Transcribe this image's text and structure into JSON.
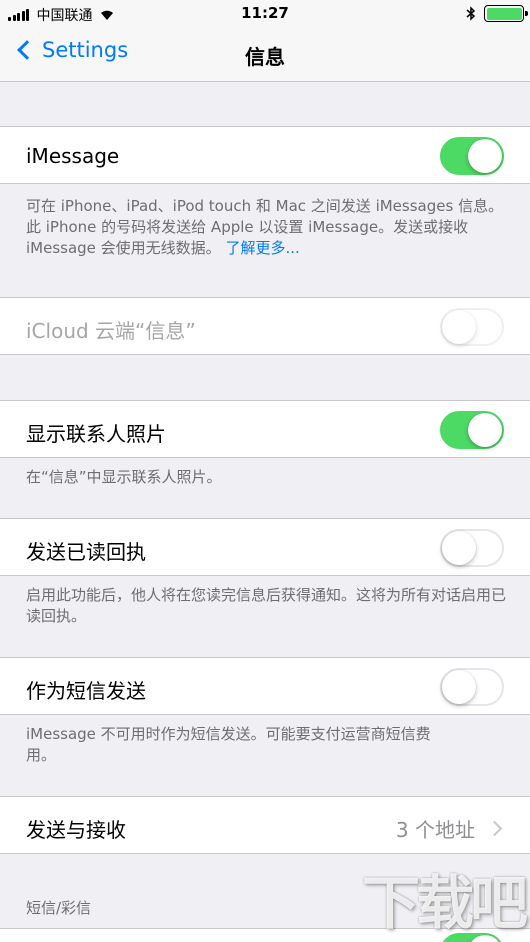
{
  "status_bar": {
    "carrier": "中国联通",
    "time": "11:27",
    "battery_color": "#4cd964"
  },
  "nav": {
    "back_label": "Settings",
    "title": "信息"
  },
  "imessage": {
    "label": "iMessage",
    "on": true,
    "footer": "可在 iPhone、iPad、iPod touch 和 Mac 之间发送 iMessages 信息。此 iPhone 的号码将发送给 Apple 以设置 iMessage。发送或接收 iMessage 会使用无线数据。",
    "learn_more": "了解更多..."
  },
  "icloud": {
    "label": "iCloud 云端“信息”",
    "on": false,
    "disabled": true
  },
  "contact_photos": {
    "label": "显示联系人照片",
    "on": true,
    "footer": "在“信息”中显示联系人照片。"
  },
  "read_receipts": {
    "label": "发送已读回执",
    "on": false,
    "footer": "启用此功能后，他人将在您读完信息后获得通知。这将为所有对话启用已读回执。"
  },
  "send_as_sms": {
    "label": "作为短信发送",
    "on": false,
    "footer": "iMessage 不可用时作为短信发送。可能要支付运营商短信费用。"
  },
  "send_receive": {
    "label": "发送与接收",
    "value": "3 个地址"
  },
  "sms_mms_header": "短信/彩信",
  "watermark": "下载吧",
  "colors": {
    "accent": "#007aff",
    "toggle_on": "#4cd964",
    "background": "#efeff4"
  }
}
